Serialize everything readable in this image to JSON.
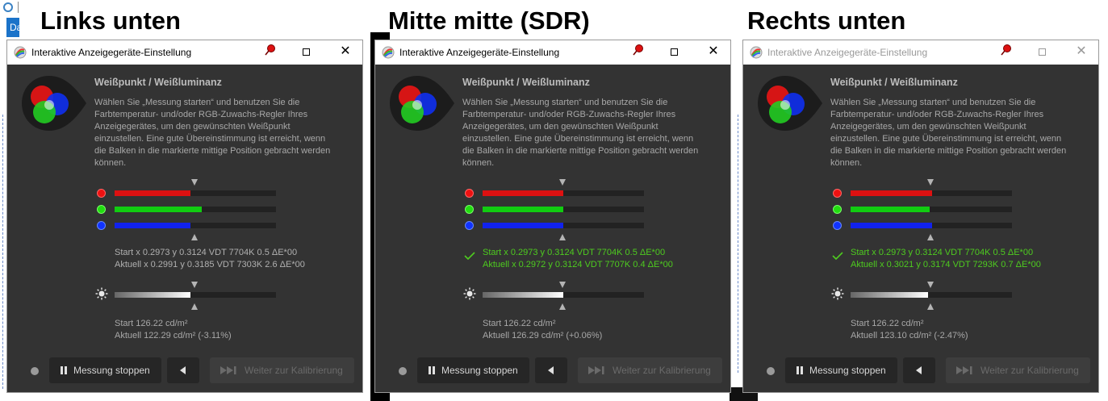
{
  "headings": [
    {
      "text": "Links unten"
    },
    {
      "text": "Mitte mitte (SDR)"
    },
    {
      "text": "Rechts unten"
    }
  ],
  "background": {
    "tab_fragment": "Da"
  },
  "colors": {
    "window_bg": "#333333",
    "red": "#ee1111",
    "green": "#22dd11",
    "blue": "#1133ff",
    "ok_green": "#4ecb1f",
    "text": "#a8a8a8"
  },
  "windows": [
    {
      "title": "Interaktive Anzeigegeräte-Einstellung",
      "active": true,
      "section_title": "Weißpunkt / Weißluminanz",
      "description": "Wählen Sie „Messung starten“ und benutzen Sie die Farbtemperatur- und/oder RGB-Zuwachs-Regler Ihres Anzeigegerätes, um den gewünschten Weißpunkt einzustellen. Eine gute Übereinstimmung ist erreicht, wenn die Balken in die markierte mittige Position gebracht werden können.",
      "bars": {
        "red": 0.47,
        "green": 0.54,
        "blue": 0.47
      },
      "rgb_ok": false,
      "start_line": "Start x 0.2973 y 0.3124 VDT 7704K 0.5 ΔE*00",
      "current_line": "Aktuell x 0.2991 y 0.3185 VDT 7303K 2.6 ΔE*00",
      "luminance_bar": 0.47,
      "lum_start": "Start 126.22 cd/m²",
      "lum_current": "Aktuell 122.29 cd/m² (-3.11%)",
      "buttons": {
        "stop": "Messung stoppen",
        "next": "Weiter zur Kalibrierung"
      }
    },
    {
      "title": "Interaktive Anzeigegeräte-Einstellung",
      "active": true,
      "section_title": "Weißpunkt / Weißluminanz",
      "description": "Wählen Sie „Messung starten“ und benutzen Sie die Farbtemperatur- und/oder RGB-Zuwachs-Regler Ihres Anzeigegerätes, um den gewünschten Weißpunkt einzustellen. Eine gute Übereinstimmung ist erreicht, wenn die Balken in die markierte mittige Position gebracht werden können.",
      "bars": {
        "red": 0.5,
        "green": 0.5,
        "blue": 0.5
      },
      "rgb_ok": true,
      "start_line": "Start x 0.2973 y 0.3124 VDT 7704K 0.5 ΔE*00",
      "current_line": "Aktuell x 0.2972 y 0.3124 VDT 7707K 0.4 ΔE*00",
      "luminance_bar": 0.5,
      "lum_start": "Start 126.22 cd/m²",
      "lum_current": "Aktuell 126.29 cd/m² (+0.06%)",
      "buttons": {
        "stop": "Messung stoppen",
        "next": "Weiter zur Kalibrierung"
      }
    },
    {
      "title": "Interaktive Anzeigegeräte-Einstellung",
      "active": false,
      "section_title": "Weißpunkt / Weißluminanz",
      "description": "Wählen Sie „Messung starten“ und benutzen Sie die Farbtemperatur- und/oder RGB-Zuwachs-Regler Ihres Anzeigegerätes, um den gewünschten Weißpunkt einzustellen. Eine gute Übereinstimmung ist erreicht, wenn die Balken in die markierte mittige Position gebracht werden können.",
      "bars": {
        "red": 0.505,
        "green": 0.49,
        "blue": 0.505
      },
      "rgb_ok": true,
      "start_line": "Start x 0.2973 y 0.3124 VDT 7704K 0.5 ΔE*00",
      "current_line": "Aktuell x 0.3021 y 0.3174 VDT 7293K 0.7 ΔE*00",
      "luminance_bar": 0.48,
      "lum_start": "Start 126.22 cd/m²",
      "lum_current": "Aktuell 123.10 cd/m² (-2.47%)",
      "buttons": {
        "stop": "Messung stoppen",
        "next": "Weiter zur Kalibrierung"
      }
    }
  ]
}
